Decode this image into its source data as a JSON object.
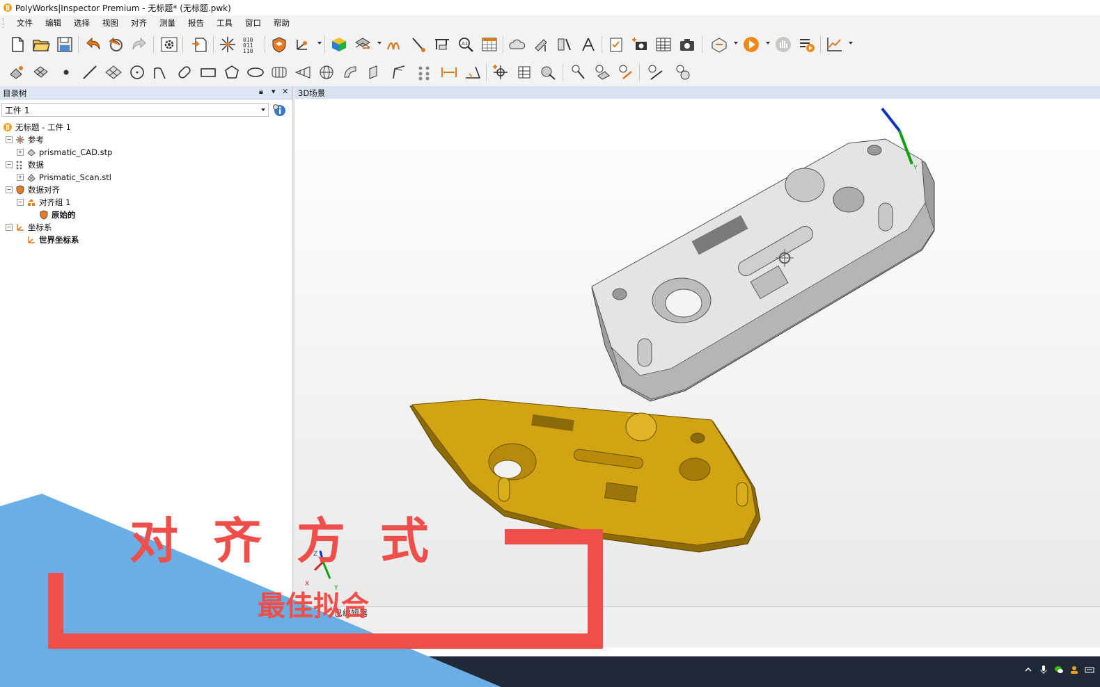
{
  "window": {
    "title": "PolyWorks|Inspector Premium - 无标题* (无标题.pwk)"
  },
  "menu": [
    "文件",
    "编辑",
    "选择",
    "视图",
    "对齐",
    "测量",
    "报告",
    "工具",
    "窗口",
    "帮助"
  ],
  "tree_panel": {
    "header": "目录树",
    "workpiece_select": "工件 1",
    "nodes": [
      {
        "label": "无标题 - 工件 1",
        "icon": "project-icon"
      },
      {
        "label": "参考",
        "icon": "reference-icon"
      },
      {
        "label": "prismatic_CAD.stp",
        "icon": "cad-object-icon"
      },
      {
        "label": "数据",
        "icon": "data-icon"
      },
      {
        "label": "Prismatic_Scan.stl",
        "icon": "mesh-object-icon"
      },
      {
        "label": "数据对齐",
        "icon": "alignment-icon"
      },
      {
        "label": "对齐组 1",
        "icon": "alignment-group-icon"
      },
      {
        "label": "原始的",
        "icon": "original-alignment-icon"
      },
      {
        "label": "坐标系",
        "icon": "coordinate-system-icon"
      },
      {
        "label": "世界坐标系",
        "icon": "world-axes-icon"
      }
    ]
  },
  "scene": {
    "header": "3D场景",
    "axis_labels": {
      "x": "X",
      "y": "Y",
      "z": "Z"
    },
    "status_text": "已编辑器"
  },
  "overlay": {
    "title": "对齐方式",
    "subtitle": "最佳拟合",
    "colors": {
      "accent_red": "#ef4f4a",
      "triangle_blue": "#6aaee6"
    }
  },
  "colors": {
    "cad_model": "#d8d8d8",
    "scan_model": "#c99a0c",
    "axis_x": "#d02020",
    "axis_y": "#10a010",
    "axis_z": "#1030c0"
  }
}
